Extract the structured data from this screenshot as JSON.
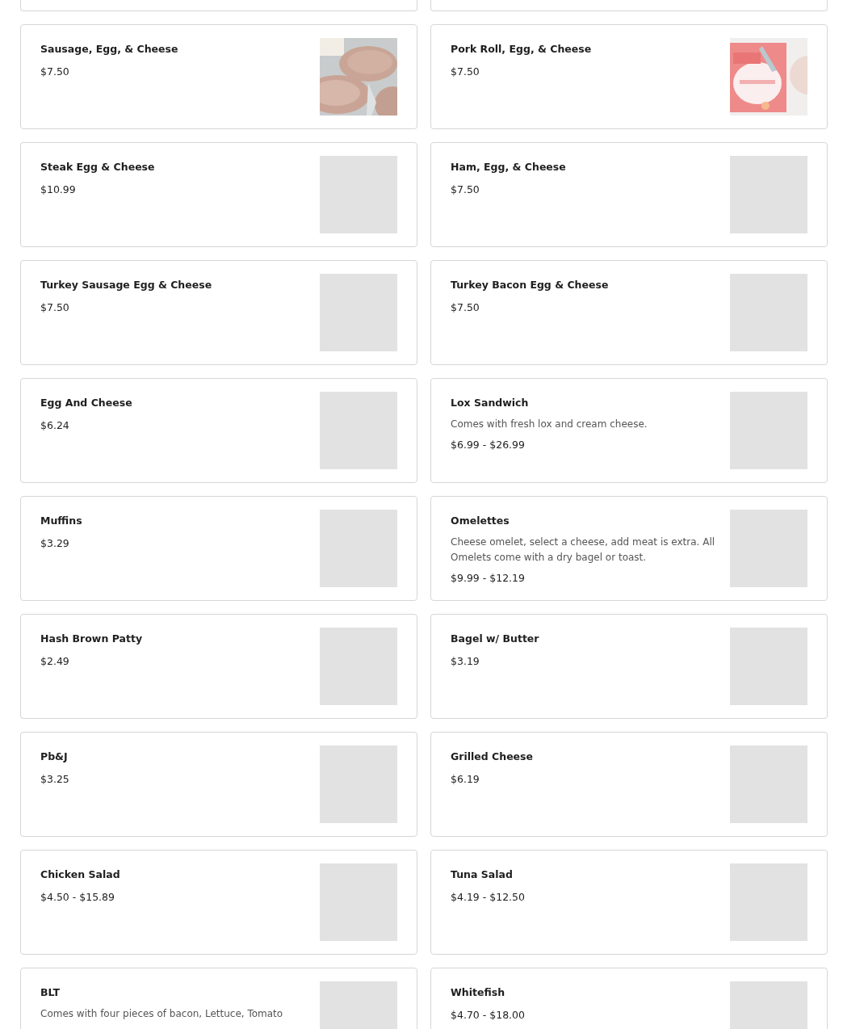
{
  "menu_items": [
    {
      "name": "Sausage, Egg, & Cheese",
      "price": "$7.50",
      "image": {
        "kind": "sausage"
      }
    },
    {
      "name": "Pork Roll, Egg, & Cheese",
      "price": "$7.50",
      "image": {
        "kind": "porkroll"
      }
    },
    {
      "name": "Steak Egg & Cheese",
      "price": "$10.99",
      "image": {
        "kind": "placeholder"
      }
    },
    {
      "name": "Ham, Egg, & Cheese",
      "price": "$7.50",
      "image": {
        "kind": "placeholder"
      }
    },
    {
      "name": "Turkey Sausage Egg & Cheese",
      "price": "$7.50",
      "image": {
        "kind": "placeholder"
      }
    },
    {
      "name": "Turkey Bacon Egg & Cheese",
      "price": "$7.50",
      "image": {
        "kind": "placeholder"
      }
    },
    {
      "name": "Egg And Cheese",
      "price": "$6.24",
      "image": {
        "kind": "placeholder"
      }
    },
    {
      "name": "Lox Sandwich",
      "description": "Comes with fresh lox and cream cheese.",
      "price": "$6.99 - $26.99",
      "image": {
        "kind": "placeholder"
      }
    },
    {
      "name": "Muffins",
      "price": "$3.29",
      "image": {
        "kind": "placeholder"
      }
    },
    {
      "name": "Omelettes",
      "description": "Cheese omelet, select a cheese, add meat is extra. All Omelets come with a dry bagel or toast.",
      "price": "$9.99 - $12.19",
      "image": {
        "kind": "placeholder"
      }
    },
    {
      "name": "Hash Brown Patty",
      "price": "$2.49",
      "image": {
        "kind": "placeholder"
      }
    },
    {
      "name": "Bagel w/ Butter",
      "price": "$3.19",
      "image": {
        "kind": "placeholder"
      }
    },
    {
      "name": "Pb&J",
      "price": "$3.25",
      "image": {
        "kind": "placeholder"
      }
    },
    {
      "name": "Grilled Cheese",
      "price": "$6.19",
      "image": {
        "kind": "placeholder"
      }
    },
    {
      "name": "Chicken Salad",
      "price": "$4.50 - $15.89",
      "image": {
        "kind": "placeholder"
      }
    },
    {
      "name": "Tuna Salad",
      "price": "$4.19 - $12.50",
      "image": {
        "kind": "placeholder"
      }
    },
    {
      "name": "BLT",
      "description": "Comes with four pieces of bacon, Lettuce, Tomato",
      "image": {
        "kind": "placeholder"
      }
    },
    {
      "name": "Whitefish",
      "price": "$4.70 - $18.00",
      "image": {
        "kind": "placeholder"
      }
    }
  ]
}
